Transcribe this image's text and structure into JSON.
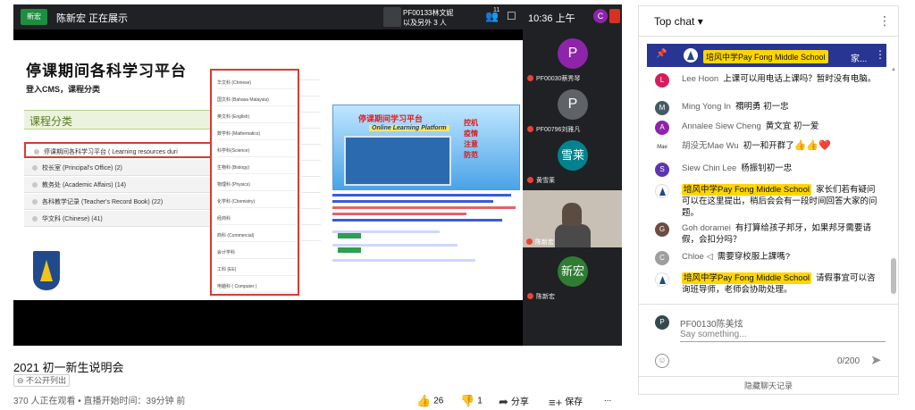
{
  "video": {
    "top_bar": {
      "logo": "新宏",
      "presenter": "陈新宏 正在展示",
      "pinned_line1": "PF00133林文妮",
      "pinned_line2": "以及另外 3 人",
      "people_count": "11",
      "time": "10:36 上午",
      "avatar_letter": "C"
    },
    "slide": {
      "title": "停课期间各科学习平台",
      "subtitle": "登入CMS，课程分类",
      "category_header": "课程分类",
      "categories": [
        "停课期间各科学习平台 ( Learning resources duri",
        "校长室 (Principal's Office) (2)",
        "教务处 (Academic Affairs) (14)",
        "各科教学记录 (Teacher's Record Book) (22)",
        "华文科 (Chinese) (41)"
      ],
      "subjects": [
        "华文科 (Chinese)",
        "国文科 (Bahasa Malaysia)",
        "英文科 (English)",
        "数学科 (Mathematics)",
        "科学科(Science)",
        "生物科 (Biology)",
        "物理科 (Physics)",
        "化学科 (Chemistry)",
        "经商科",
        "商科 (Commercial)",
        "会计学科",
        "工科 (EE)",
        "电脑科 ( Computer )"
      ],
      "banner_title": "停课期间学习平台",
      "banner_en": "Online Learning Platform",
      "banner_tags": [
        "控机",
        "疫情",
        "注意",
        "防范"
      ]
    },
    "participants": [
      {
        "letter": "P",
        "name": "PF00030蔡秀琴",
        "color": "#8e24aa"
      },
      {
        "letter": "P",
        "name": "PF00796刘雅凡",
        "color": "#5f6368"
      },
      {
        "letter": "雪莱",
        "name": "黄雪莱",
        "color": "#00838f"
      },
      {
        "letter": "",
        "name": "陈新宏",
        "color": ""
      },
      {
        "letter": "新宏",
        "name": "陈新宏",
        "color": "#2e7d32"
      }
    ]
  },
  "below": {
    "title": "2021 初一新生说明会",
    "privacy": "不公开列出",
    "meta": "370 人正在观看 • 直播开始时间：39分钟 前",
    "likes": "26",
    "dislikes": "1",
    "share": "分享",
    "save": "保存",
    "more": "..."
  },
  "chat": {
    "header": "Top chat",
    "pinned": {
      "author": "培风中学Pay Fong Middle School",
      "text": "家..."
    },
    "messages": [
      {
        "avatar": "L",
        "color": "#d81b60",
        "author": "Lee Hoon",
        "badge": false,
        "text": "上课可以用电话上课吗？暂时没有电脑。"
      },
      {
        "avatar": "M",
        "color": "#455a64",
        "author": "Ming Yong In",
        "badge": false,
        "text": "禤明勇 初一忠"
      },
      {
        "avatar": "A",
        "color": "#8e24aa",
        "author": "Annalee Siew Cheng",
        "badge": false,
        "text": "黄文宜 初一爱"
      },
      {
        "avatar": "Mae",
        "color": "#ffffff",
        "author": "胡没无Mae Wu",
        "badge": false,
        "text": "初一和开群了",
        "emoji": "👍👍❤️"
      },
      {
        "avatar": "S",
        "color": "#5e35b1",
        "author": "Siew Chin Lee",
        "badge": false,
        "text": "杨振钊初一忠"
      },
      {
        "avatar": "",
        "color": "",
        "author": "培风中学Pay Fong Middle School",
        "badge": true,
        "text": "家长们若有疑问可以在这里提出，稍后会会有一段时间回答大家的问题。"
      },
      {
        "avatar": "G",
        "color": "#6d4c41",
        "author": "Goh doramei",
        "badge": false,
        "text": "有打算给孩子邦牙，如果邦牙需要请假，会扣分吗？"
      },
      {
        "avatar": "C",
        "color": "#9e9e9e",
        "author": "Chloe ◁",
        "badge": false,
        "text": "需要穿校服上課嗎?"
      },
      {
        "avatar": "",
        "color": "",
        "author": "培风中学Pay Fong Middle School",
        "badge": true,
        "text": "请假事宜可以咨询班导师，老师会协助处理。"
      }
    ],
    "composer": {
      "avatar": "P",
      "user": "PF00130陈美炫",
      "placeholder": "Say something...",
      "counter": "0/200"
    },
    "hide": "隐藏聊天记录"
  }
}
